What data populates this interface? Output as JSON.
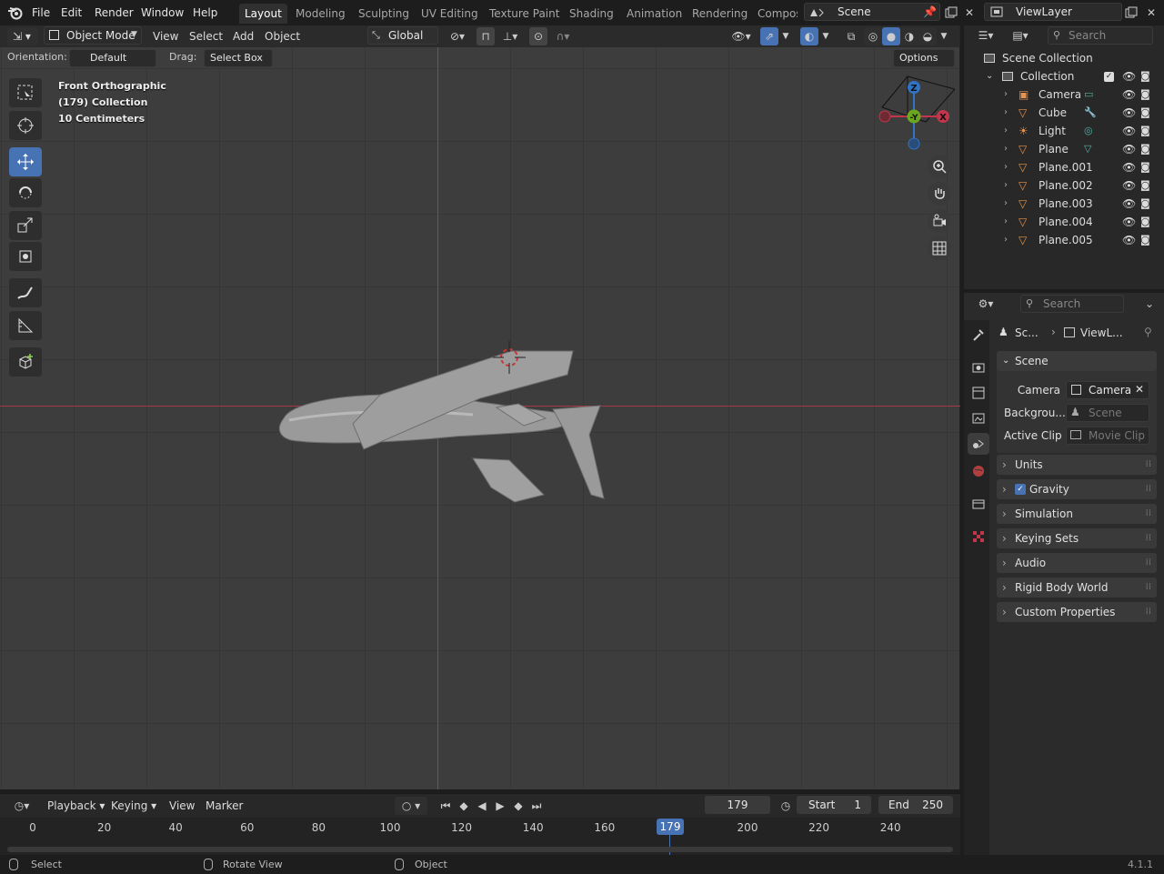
{
  "app": {
    "version": "4.1.1"
  },
  "menus": [
    "File",
    "Edit",
    "Render",
    "Window",
    "Help"
  ],
  "workspaces": [
    "Layout",
    "Modeling",
    "Sculpting",
    "UV Editing",
    "Texture Paint",
    "Shading",
    "Animation",
    "Rendering",
    "Compos"
  ],
  "scene_selector": {
    "value": "Scene"
  },
  "view_layer_selector": {
    "value": "ViewLayer"
  },
  "viewport": {
    "mode": "Object Mode",
    "menus": [
      "View",
      "Select",
      "Add",
      "Object"
    ],
    "transform_orientation": "Global",
    "orientation_label": "Orientation:",
    "orientation_value": "Default",
    "drag_label": "Drag:",
    "drag_value": "Select Box",
    "options_label": "Options",
    "overlay_view": "Front Orthographic",
    "overlay_collection": "(179) Collection",
    "overlay_scale": "10 Centimeters",
    "gizmo": {
      "z": "Z",
      "y": "-Y",
      "x": "X"
    }
  },
  "outliner": {
    "search_placeholder": "Search",
    "root": "Scene Collection",
    "collection": "Collection",
    "items": [
      "Camera",
      "Cube",
      "Light",
      "Plane",
      "Plane.001",
      "Plane.002",
      "Plane.003",
      "Plane.004",
      "Plane.005"
    ]
  },
  "properties": {
    "search_placeholder": "Search",
    "breadcrumb_scene": "Sc...",
    "breadcrumb_layer": "ViewL...",
    "scene_panel": "Scene",
    "camera_label": "Camera",
    "camera_value": "Camera",
    "background_label": "Backgrou...",
    "background_value": "Scene",
    "clip_label": "Active Clip",
    "clip_value": "Movie Clip",
    "panels": [
      "Units",
      "Gravity",
      "Simulation",
      "Keying Sets",
      "Audio",
      "Rigid Body World",
      "Custom Properties"
    ],
    "gravity_checked": true
  },
  "timeline": {
    "menus": [
      "Playback",
      "Keying",
      "View",
      "Marker"
    ],
    "current_frame": "179",
    "start_label": "Start",
    "start": "1",
    "end_label": "End",
    "end": "250",
    "ticks": [
      "0",
      "20",
      "40",
      "60",
      "80",
      "100",
      "120",
      "140",
      "160",
      "200",
      "220",
      "240"
    ],
    "playhead": "179"
  },
  "statusbar": {
    "select": "Select",
    "rotate": "Rotate View",
    "object": "Object",
    "version": "4.1.1"
  },
  "colors": {
    "accent": "#4772b3",
    "axis_x": "#c2354a",
    "axis_y": "#6ba81e",
    "axis_z": "#2f74c5",
    "object_icon": "#e8924a"
  }
}
